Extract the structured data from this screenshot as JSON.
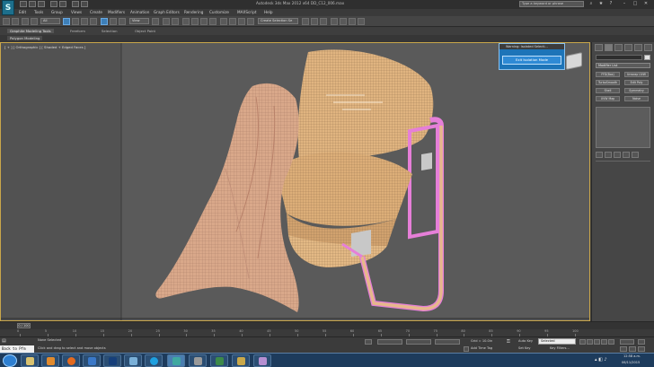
{
  "window": {
    "title": "Autodesk 3ds Max  2012 x64     DD_C12_006.max",
    "search_placeholder": "Type a keyword or phrase",
    "logo_letter": "S"
  },
  "menu": [
    "Edit",
    "Tools",
    "Group",
    "Views",
    "Create",
    "Modifiers",
    "Animation",
    "Graph Editors",
    "Rendering",
    "Customize",
    "MAXScript",
    "Help"
  ],
  "toolbar": {
    "selection_filter": "All",
    "ref_coord": "View",
    "named_selection": "Create Selection Se"
  },
  "ribbon": {
    "tabs": [
      "Graphite Modeling Tools",
      "Freeform",
      "Selection",
      "Object Paint"
    ],
    "active_tab": "Graphite Modeling Tools",
    "panel": "Polygon Modeling"
  },
  "viewport": {
    "label": "[ + ] [ Orthographic ] [ Shaded + Edged Faces ]",
    "cloth_color": "#d9a88a",
    "wood_color": "#e0b480",
    "frame_color": "#e67fd8",
    "border_color": "#c9a64a"
  },
  "warning": {
    "title": "Warning: Isolated Selecti...",
    "button": "Exit Isolation Mode"
  },
  "command_panel": {
    "modifier_list": "Modifier List",
    "buttons": [
      "FFD(Box)",
      "Unwrap UVW",
      "TurboSmooth",
      "Edit Poly",
      "Shell",
      "Symmetry",
      "UVW Map",
      "Noise",
      "Displacement",
      "FFD 2x2x2"
    ]
  },
  "timeline": {
    "slider": "0 / 100",
    "ticks": [
      "0",
      "5",
      "10",
      "15",
      "20",
      "25",
      "30",
      "35",
      "40",
      "45",
      "50",
      "55",
      "60",
      "65",
      "70",
      "75",
      "80",
      "85",
      "90",
      "95",
      "100"
    ]
  },
  "status": {
    "maxscript": "Back to Pfm",
    "selection": "None Selected",
    "prompt": "Click and drag to select and move objects",
    "grid": "Grid = 10.0in",
    "auto_key": "Auto Key",
    "set_key": "Set Key",
    "selected": "Selected",
    "key_filters": "Key Filters...",
    "add_time_tag": "Add Time Tag"
  },
  "taskbar": {
    "apps": [
      "explorer-icon",
      "media-player-icon",
      "firefox-icon",
      "outlook-icon",
      "photoshop-icon",
      "paint-icon",
      "skype-icon",
      "3dsmax-icon",
      "capture-icon",
      "network-icon",
      "folder-icon",
      "files-icon"
    ],
    "time": "12:58 a.m.",
    "date": "06/11/2015"
  }
}
